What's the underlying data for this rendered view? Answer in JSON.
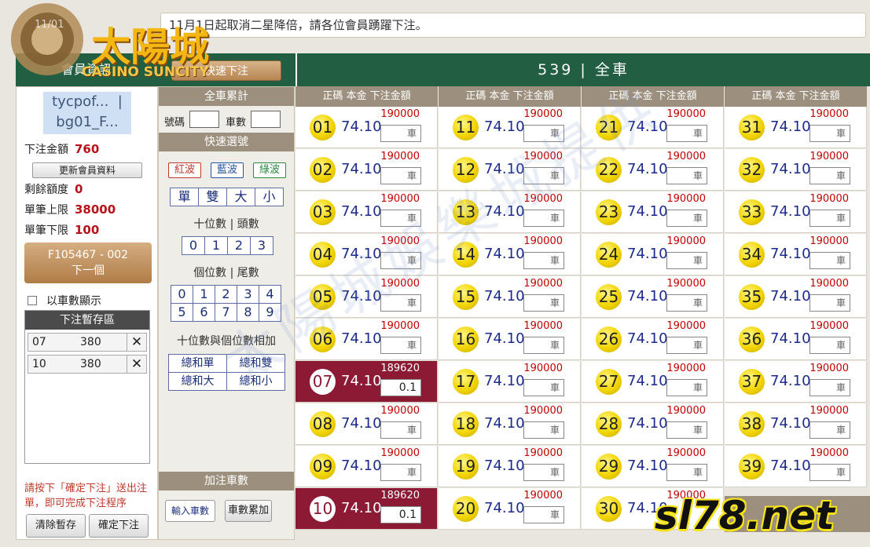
{
  "logo": {
    "main_text": "太陽城",
    "sub_text": "CASINO SUNCITY",
    "partial_text": "11/01"
  },
  "notice": "11月1日起取消二星降倍，請各位會員踴躍下注。",
  "header": {
    "member_info": "會員資訊",
    "quick_bet": "快速下注",
    "title": "539 | 全車"
  },
  "left": {
    "user_line1": "tycpof...  |",
    "user_line2": "bg01_F...",
    "bet_total_label": "下注金額",
    "bet_total": "760",
    "update_btn": "更新會員資料",
    "remaining_label": "剩餘額度",
    "remaining": "0",
    "max_label": "單筆上限",
    "max": "38000",
    "min_label": "單筆下限",
    "min": "100",
    "next_line1": "F105467 - 002",
    "next_line2": "下一個",
    "checkbox_label": "以車數顯示",
    "staging_title": "下注暫存區",
    "staging": [
      {
        "num": "07",
        "val": "380"
      },
      {
        "num": "10",
        "val": "380"
      }
    ],
    "hint": "請按下「確定下注」送出注單，即可完成下注程序",
    "clear_btn": "清除暫存",
    "confirm_btn": "確定下注"
  },
  "mid": {
    "total_title": "全車累計",
    "num_label": "號碼",
    "car_label": "車數",
    "quick_title": "快速選號",
    "waves": [
      {
        "label": "紅波",
        "color": "#c0392b"
      },
      {
        "label": "藍波",
        "color": "#2653a4"
      },
      {
        "label": "綠波",
        "color": "#2b8a3e"
      }
    ],
    "oddeven": [
      "單",
      "雙",
      "大",
      "小"
    ],
    "tens_title": "十位數 | 頭數",
    "tens": [
      "0",
      "1",
      "2",
      "3"
    ],
    "units_title": "個位數 | 尾數",
    "units": [
      "0",
      "1",
      "2",
      "3",
      "4",
      "5",
      "6",
      "7",
      "8",
      "9"
    ],
    "sum_title": "十位數與個位數相加",
    "sum_btns": [
      "總和單",
      "總和雙",
      "總和大",
      "總和小"
    ],
    "add_title": "加注車數",
    "input_btn": "輸入車數",
    "accum_btn": "車數累加"
  },
  "grid": {
    "col_header": "正碼  本金  下注金額",
    "placeholder": "車",
    "rate": "74.10",
    "limit": "190000",
    "rows": [
      [
        {
          "n": "01"
        },
        {
          "n": "11"
        },
        {
          "n": "21"
        },
        {
          "n": "31"
        }
      ],
      [
        {
          "n": "02"
        },
        {
          "n": "12"
        },
        {
          "n": "22"
        },
        {
          "n": "32"
        }
      ],
      [
        {
          "n": "03"
        },
        {
          "n": "13"
        },
        {
          "n": "23"
        },
        {
          "n": "33"
        }
      ],
      [
        {
          "n": "04"
        },
        {
          "n": "14"
        },
        {
          "n": "24"
        },
        {
          "n": "34"
        }
      ],
      [
        {
          "n": "05"
        },
        {
          "n": "15"
        },
        {
          "n": "25"
        },
        {
          "n": "35"
        }
      ],
      [
        {
          "n": "06"
        },
        {
          "n": "16"
        },
        {
          "n": "26"
        },
        {
          "n": "36"
        }
      ],
      [
        {
          "n": "07",
          "selected": true,
          "limit": "189620",
          "value": "0.1"
        },
        {
          "n": "17"
        },
        {
          "n": "27"
        },
        {
          "n": "37"
        }
      ],
      [
        {
          "n": "08"
        },
        {
          "n": "18"
        },
        {
          "n": "28"
        },
        {
          "n": "38"
        }
      ],
      [
        {
          "n": "09"
        },
        {
          "n": "19"
        },
        {
          "n": "29"
        },
        {
          "n": "39"
        }
      ],
      [
        {
          "n": "10",
          "selected": true,
          "limit": "189620",
          "value": "0.1"
        },
        {
          "n": "20"
        },
        {
          "n": "30",
          "limit": "190000",
          "partial": true
        }
      ]
    ]
  },
  "watermark": "太陽城娛樂城提供",
  "brand": "sl78.net",
  "colors": {
    "header_green": "#225e41",
    "section_brown": "#9c8f7d",
    "selected": "#8c1a35",
    "ball_yellow": "#f2d400"
  }
}
